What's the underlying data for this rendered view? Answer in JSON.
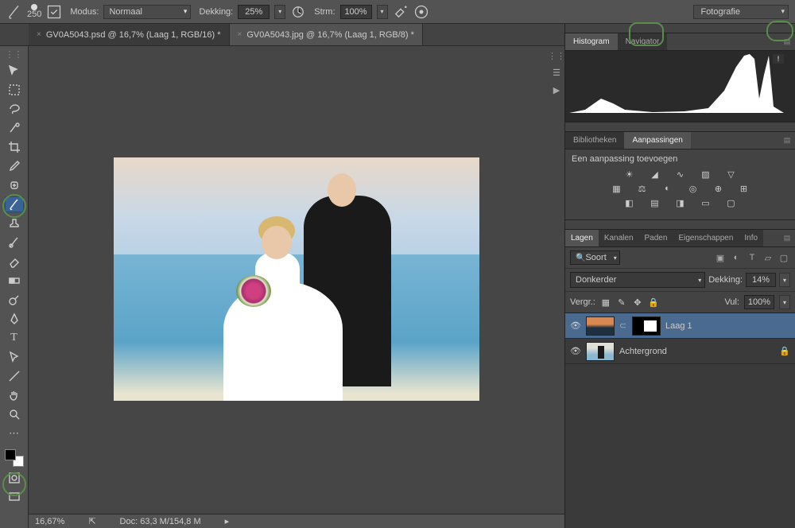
{
  "options": {
    "brush_size": "250",
    "mode_label": "Modus:",
    "mode_value": "Normaal",
    "opacity_label": "Dekking:",
    "opacity_value": "25%",
    "flow_label": "Strm:",
    "flow_value": "100%"
  },
  "workspace": "Fotografie",
  "tabs": [
    {
      "title": "GV0A5043.psd @ 16,7% (Laag 1, RGB/16) *"
    },
    {
      "title": "GV0A5043.jpg @ 16,7% (Laag 1, RGB/8) *"
    }
  ],
  "status": {
    "zoom": "16,67%",
    "doc": "Doc: 63,3 M/154,8 M"
  },
  "panels": {
    "histogram_tabs": [
      "Histogram",
      "Navigator"
    ],
    "lib_tabs": [
      "Bibliotheken",
      "Aanpassingen"
    ],
    "adjust_title": "Een aanpassing toevoegen",
    "layer_tabs": [
      "Lagen",
      "Kanalen",
      "Paden",
      "Eigenschappen",
      "Info"
    ],
    "kind_label": "Soort",
    "blend_mode": "Donkerder",
    "blend_opacity_label": "Dekking:",
    "blend_opacity_value": "14%",
    "lock_label": "Vergr.:",
    "fill_label": "Vul:",
    "fill_value": "100%",
    "layers": [
      {
        "name": "Laag 1"
      },
      {
        "name": "Achtergrond"
      }
    ]
  }
}
